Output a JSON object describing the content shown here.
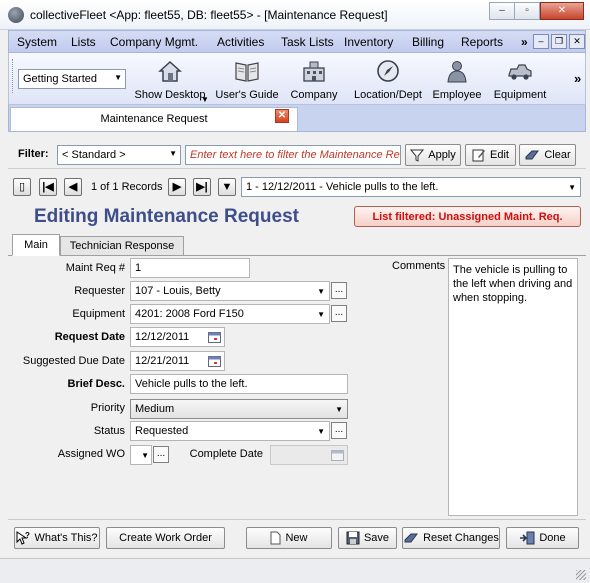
{
  "window": {
    "title": "collectiveFleet <App: fleet55, DB: fleet55> - [Maintenance Request]",
    "controls": {
      "minimize": "–",
      "restore": "▫",
      "close": "✕"
    }
  },
  "menubar": {
    "items": [
      "System",
      "Lists",
      "Company Mgmt.",
      "Activities",
      "Task Lists",
      "Inventory",
      "Billing",
      "Reports"
    ],
    "overflow": "»",
    "mdi_controls": {
      "minimize": "–",
      "restore": "❐",
      "close": "✕"
    }
  },
  "toolbar": {
    "dropdown_value": "Getting Started",
    "buttons": [
      {
        "label": "Show Desktop",
        "icon": "house-icon"
      },
      {
        "label": "User's Guide",
        "icon": "book-icon"
      },
      {
        "label": "Company",
        "icon": "building-icon"
      },
      {
        "label": "Location/Dept",
        "icon": "compass-icon"
      },
      {
        "label": "Employee",
        "icon": "person-icon"
      },
      {
        "label": "Equipment",
        "icon": "vehicle-icon"
      }
    ],
    "overflow": "»"
  },
  "doc_tab": {
    "label": "Maintenance Request",
    "close": "✕"
  },
  "filter": {
    "label": "Filter:",
    "preset": "< Standard >",
    "placeholder": "Enter text here to filter the Maintenance Re",
    "apply": "Apply",
    "edit": "Edit",
    "clear": "Clear"
  },
  "navigator": {
    "record_text": "1 of 1 Records",
    "record_select": "1 - 12/12/2011 - Vehicle pulls to the left."
  },
  "heading": {
    "title": "Editing Maintenance Request",
    "filter_notice": "List filtered: Unassigned Maint. Req."
  },
  "tabs": {
    "main": "Main",
    "technician": "Technician Response"
  },
  "form": {
    "maint_req_label": "Maint Req #",
    "maint_req_value": "1",
    "requester_label": "Requester",
    "requester_value": "107 - Louis, Betty",
    "equipment_label": "Equipment",
    "equipment_value": "4201: 2008 Ford F150",
    "request_date_label": "Request Date",
    "request_date_value": "12/12/2011",
    "due_date_label": "Suggested Due Date",
    "due_date_value": "12/21/2011",
    "brief_desc_label": "Brief Desc.",
    "brief_desc_value": "Vehicle pulls to the left.",
    "priority_label": "Priority",
    "priority_value": "Medium",
    "status_label": "Status",
    "status_value": "Requested",
    "assigned_wo_label": "Assigned WO",
    "assigned_wo_value": "",
    "complete_date_label": "Complete Date",
    "complete_date_value": "",
    "comments_label": "Comments",
    "comments_value": "The vehicle is pulling to the left when driving and when stopping.",
    "ellipsis": "..."
  },
  "bottom_buttons": {
    "whats_this": "What's This?",
    "create_wo": "Create Work Order",
    "new": "New",
    "save": "Save",
    "reset": "Reset Changes",
    "done": "Done"
  },
  "colors": {
    "heading": "#3d4e8a",
    "alert_text": "#cc1010",
    "menubar": "#c9d2f0"
  }
}
